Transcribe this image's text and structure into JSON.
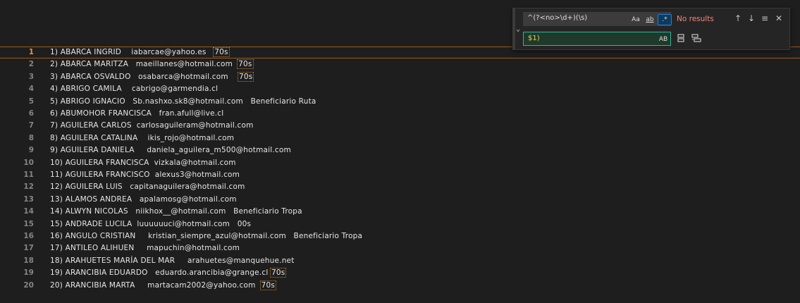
{
  "find": {
    "query": "^(?<no>\\d+)(\\s)",
    "match_case_label": "Aa",
    "whole_word_label": "ab",
    "regex_label": ".*",
    "status": "No results",
    "prev_icon": "↑",
    "next_icon": "↓",
    "selection_icon": "≡",
    "close_icon": "✕",
    "replace_value": "$1)",
    "preserve_case_label": "AB",
    "replace_one_icon": "replace-icon",
    "replace_all_icon": "replace-all-icon"
  },
  "lines": [
    {
      "num": "1",
      "text": "1) ABARCA INGRID    iabarcae@yahoo.es   ",
      "tail": "70s",
      "hl": true
    },
    {
      "num": "2",
      "text": "2) ABARCA MARITZA   maeillanes@hotmail.com  ",
      "tail": "70s",
      "hl": true
    },
    {
      "num": "3",
      "text": "3) ABARCA OSVALDO   osabarca@hotmail.com    ",
      "tail": "70s",
      "hl": true
    },
    {
      "num": "4",
      "text": "4) ABRIGO CAMILA    cabrigo@garmendia.cl",
      "tail": "",
      "hl": false
    },
    {
      "num": "5",
      "text": "5) ABRIGO IGNACIO   Sb.nashxo.sk8@hotmail.com   Beneficiario Ruta",
      "tail": "",
      "hl": false
    },
    {
      "num": "6",
      "text": "6) ABUMOHOR FRANCISCA   fran.afull@live.cl",
      "tail": "",
      "hl": false
    },
    {
      "num": "7",
      "text": "7) AGUILERA CARLOS  carlosaguileram@hotmail.com",
      "tail": "",
      "hl": false
    },
    {
      "num": "8",
      "text": "8) AGUILERA CATALINA    ikis_rojo@hotmail.com",
      "tail": "",
      "hl": false
    },
    {
      "num": "9",
      "text": "9) AGUILERA DANIELA     daniela_aguilera_m500@hotmail.com",
      "tail": "",
      "hl": false
    },
    {
      "num": "10",
      "text": "10) AGUILERA FRANCISCA  vizkala@hotmail.com",
      "tail": "",
      "hl": false
    },
    {
      "num": "11",
      "text": "11) AGUILERA FRANCISCO  alexus3@hotmail.com",
      "tail": "",
      "hl": false
    },
    {
      "num": "12",
      "text": "12) AGUILERA LUIS   capitanaguilera@hotmail.com",
      "tail": "",
      "hl": false
    },
    {
      "num": "13",
      "text": "13) ALAMOS ANDREA   apalamosg@hotmail.com",
      "tail": "",
      "hl": false
    },
    {
      "num": "14",
      "text": "14) ALWYN NICOLAS   niikhox__@hotmail.com   Beneficiario Tropa",
      "tail": "",
      "hl": false
    },
    {
      "num": "15",
      "text": "15) ANDRADE LUCILA  luuuuuuci@hotmail.com   00s",
      "tail": "",
      "hl": false
    },
    {
      "num": "16",
      "text": "16) ANGULO CRISTIAN     kristian_siempre_azul@hotmail.com   Beneficiario Tropa",
      "tail": "",
      "hl": false
    },
    {
      "num": "17",
      "text": "17) ANTILEO ALIHUEN     mapuchin@hotmail.com",
      "tail": "",
      "hl": false
    },
    {
      "num": "18",
      "text": "18) ARAHUETES MARÍA DEL MAR     arahuetes@manquehue.net",
      "tail": "",
      "hl": false
    },
    {
      "num": "19",
      "text": "19) ARANCIBIA EDUARDO   eduardo.arancibia@grange.cl ",
      "tail": "70s",
      "hl": true
    },
    {
      "num": "20",
      "text": "20) ARANCIBIA MARTA     martacam2002@yahoo.com  ",
      "tail": "70s",
      "hl": true
    }
  ]
}
